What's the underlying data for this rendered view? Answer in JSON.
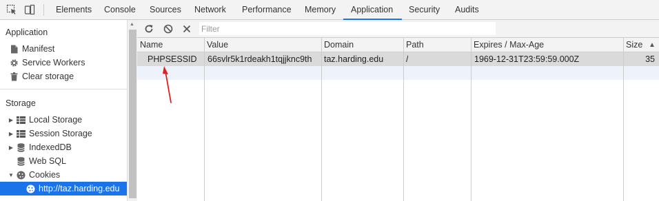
{
  "tabs": [
    "Elements",
    "Console",
    "Sources",
    "Network",
    "Performance",
    "Memory",
    "Application",
    "Security",
    "Audits"
  ],
  "active_tab": "Application",
  "sidebar": {
    "application_title": "Application",
    "application_items": [
      {
        "label": "Manifest",
        "icon": "document-icon"
      },
      {
        "label": "Service Workers",
        "icon": "gear-icon"
      },
      {
        "label": "Clear storage",
        "icon": "trash-icon"
      }
    ],
    "storage_title": "Storage",
    "storage_items": [
      {
        "label": "Local Storage",
        "icon": "grid-icon",
        "expander": "collapsed"
      },
      {
        "label": "Session Storage",
        "icon": "grid-icon",
        "expander": "collapsed"
      },
      {
        "label": "IndexedDB",
        "icon": "database-icon",
        "expander": "collapsed"
      },
      {
        "label": "Web SQL",
        "icon": "database-icon",
        "expander": "none"
      },
      {
        "label": "Cookies",
        "icon": "cookie-icon",
        "expander": "expanded"
      },
      {
        "label": "http://taz.harding.edu",
        "icon": "cookie-icon",
        "expander": "none",
        "selected": true
      }
    ]
  },
  "toolbar": {
    "refresh_icon": "refresh-icon",
    "clear_icon": "block-icon",
    "delete_icon": "close-icon",
    "filter_placeholder": "Filter"
  },
  "table": {
    "columns": [
      "Name",
      "Value",
      "Domain",
      "Path",
      "Expires / Max-Age",
      "Size"
    ],
    "sort_indicator": "▲",
    "rows": [
      [
        "PHPSESSID",
        "66svlr5k1rdeakh1tqjjknc9th",
        "taz.harding.edu",
        "/",
        "1969-12-31T23:59:59.000Z",
        "35"
      ]
    ]
  },
  "colors": {
    "accent": "#1a73e8",
    "annotation": "#e02020"
  }
}
